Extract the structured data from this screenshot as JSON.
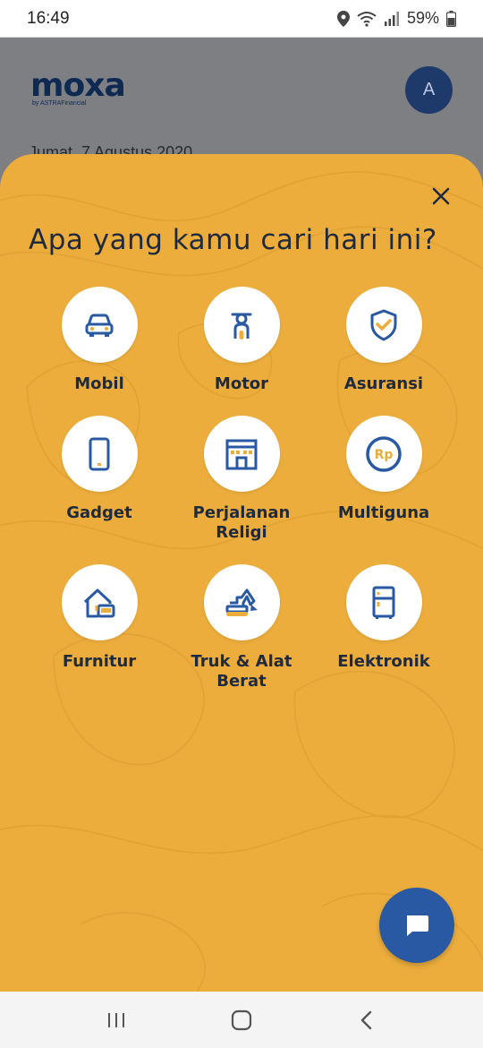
{
  "status": {
    "time": "16:49",
    "battery": "59%",
    "icons": [
      "location-icon",
      "wifi-icon",
      "signal-icon",
      "battery-icon"
    ]
  },
  "header": {
    "logo_text": "moxa",
    "logo_sub": "by ASTRAFinancial",
    "avatar_initial": "A",
    "date_text": "Jumat, 7 Agustus 2020"
  },
  "sheet": {
    "title": "Apa yang kamu cari hari ini?",
    "background_color": "#ecad3c",
    "icon_color": "#2a59a3",
    "accent_color": "#ecad3c",
    "categories": [
      {
        "label": "Mobil",
        "icon": "car-icon"
      },
      {
        "label": "Motor",
        "icon": "scooter-icon"
      },
      {
        "label": "Asuransi",
        "icon": "shield-check-icon"
      },
      {
        "label": "Gadget",
        "icon": "phone-icon"
      },
      {
        "label": "Perjalanan Religi",
        "icon": "building-icon"
      },
      {
        "label": "Multiguna",
        "icon": "rupiah-coin-icon"
      },
      {
        "label": "Furnitur",
        "icon": "house-sofa-icon"
      },
      {
        "label": "Truk & Alat Berat",
        "icon": "excavator-icon"
      },
      {
        "label": "Elektronik",
        "icon": "fridge-icon"
      }
    ]
  },
  "fab": {
    "icon": "chat-icon",
    "color": "#2a59a3"
  },
  "navbar": {
    "icons": [
      "recent-apps-icon",
      "home-icon",
      "back-icon"
    ]
  }
}
